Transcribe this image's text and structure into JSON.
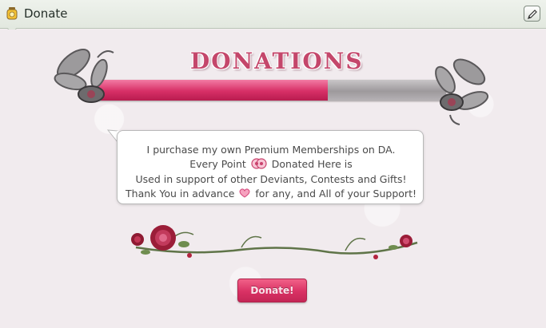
{
  "header": {
    "title": "Donate",
    "icon": "donation-jar-icon",
    "edit_icon": "pencil-icon"
  },
  "widget": {
    "title": "DONATIONS",
    "progress_fraction": 0.66,
    "message": {
      "line1": "I purchase my own Premium Memberships on DA.",
      "line2_before": "Every Point",
      "line2_after": "Donated Here is",
      "line3": "Used in support of other Deviants, Contests and Gifts!",
      "line4_before": "Thank You in advance",
      "line4_after": "for any, and All of your Support!"
    },
    "donate_label": "Donate!"
  },
  "colors": {
    "accent": "#d72f66",
    "header_bg": "#e8ede6",
    "progress_empty": "#a9a5a8"
  }
}
